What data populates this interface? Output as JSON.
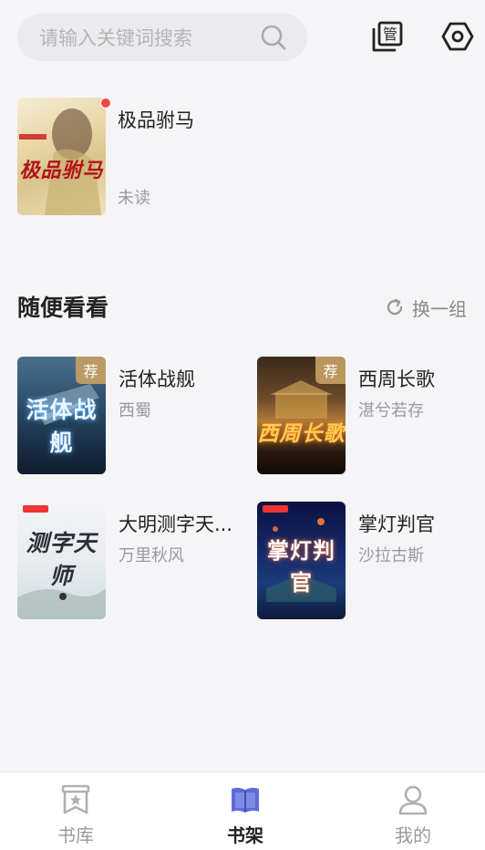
{
  "search": {
    "placeholder": "请输入关键词搜索"
  },
  "shelf": {
    "books": [
      {
        "title": "极品驸马",
        "status": "未读",
        "cover_text": "极品驸马"
      }
    ]
  },
  "recommend": {
    "section_title": "随便看看",
    "refresh_label": "换一组",
    "tag_label": "荐",
    "books": [
      {
        "title": "活体战舰",
        "author": "西蜀",
        "cover_text": "活体战舰",
        "tagged": true
      },
      {
        "title": "西周长歌",
        "author": "湛兮若存",
        "cover_text": "西周长歌",
        "tagged": true
      },
      {
        "title": "大明测字天...",
        "author": "万里秋风",
        "cover_text": "测字天师"
      },
      {
        "title": "掌灯判官",
        "author": "沙拉古斯",
        "cover_text": "掌灯判官"
      }
    ]
  },
  "nav": {
    "items": [
      {
        "label": "书库",
        "icon": "bookstore-icon"
      },
      {
        "label": "书架",
        "icon": "bookshelf-icon",
        "active": true
      },
      {
        "label": "我的",
        "icon": "profile-icon"
      }
    ]
  },
  "colors": {
    "background": "#f5f5f7",
    "accent": "#5e6bd6",
    "badge": "#f04545",
    "tag": "#c4a064"
  }
}
